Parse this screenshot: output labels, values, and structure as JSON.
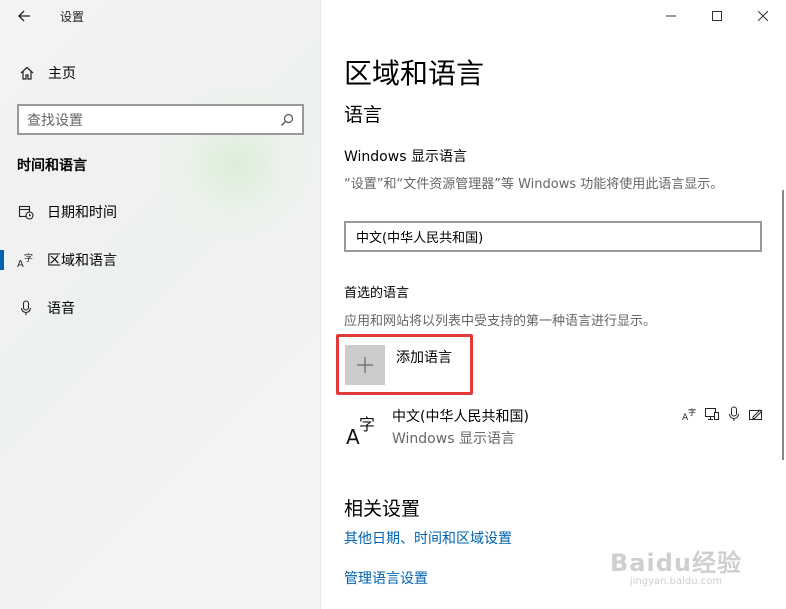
{
  "window": {
    "app_title": "设置",
    "back_icon": "back-arrow-icon",
    "controls": [
      "minimize-icon",
      "maximize-icon",
      "close-icon"
    ]
  },
  "sidebar": {
    "home_label": "主页",
    "search_placeholder": "查找设置",
    "section_title": "时间和语言",
    "items": [
      {
        "label": "日期和时间",
        "icon": "calendar-clock-icon"
      },
      {
        "label": "区域和语言",
        "icon": "language-icon",
        "active": true
      },
      {
        "label": "语音",
        "icon": "microphone-icon"
      }
    ]
  },
  "main": {
    "page_title": "区域和语言",
    "language_heading": "语言",
    "display_language_label": "Windows 显示语言",
    "display_language_desc": "“设置”和“文件资源管理器”等 Windows 功能将使用此语言显示。",
    "display_language_value": "中文(中华人民共和国)",
    "preferred_label": "首选的语言",
    "preferred_desc": "应用和网站将以列表中受支持的第一种语言进行显示。",
    "add_language_label": "添加语言",
    "language_list": [
      {
        "name": "中文(中华人民共和国)",
        "sub": "Windows 显示语言",
        "features": [
          "language-pack-icon",
          "display-icon",
          "speech-icon",
          "handwriting-icon"
        ]
      }
    ],
    "related_heading": "相关设置",
    "links": [
      "其他日期、时间和区域设置",
      "管理语言设置"
    ]
  },
  "watermark": {
    "main": "Baidu经验",
    "sub": "jingyan.baidu.com"
  },
  "colors": {
    "accent": "#0063b1",
    "highlight": "#e03a3a",
    "sidebar_bg": "#f3f3f3"
  }
}
